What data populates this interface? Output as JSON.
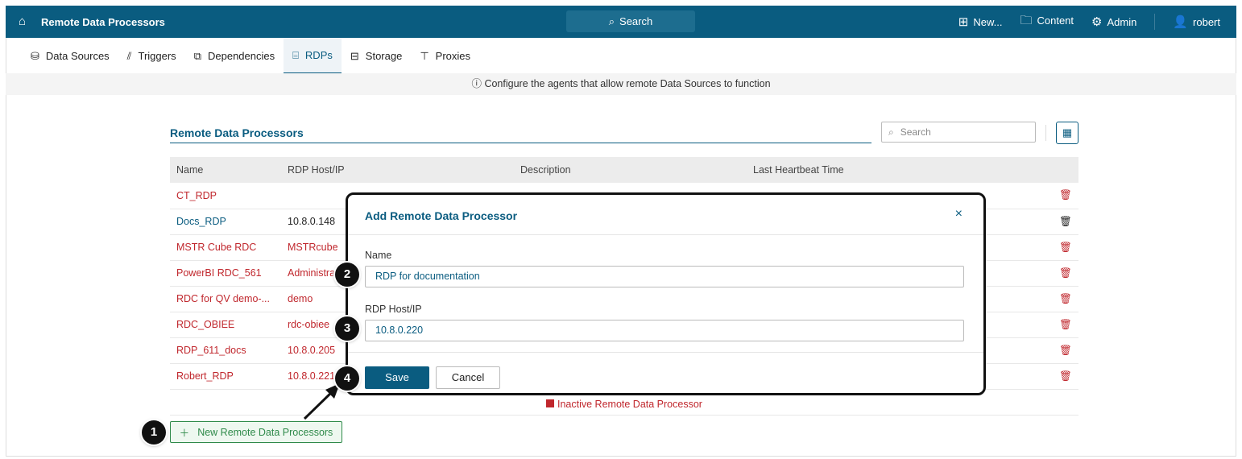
{
  "header": {
    "title": "Remote Data Processors",
    "search_label": "Search",
    "new_label": "New...",
    "content_label": "Content",
    "admin_label": "Admin",
    "user_label": "robert"
  },
  "tabs": [
    {
      "label": "Data Sources"
    },
    {
      "label": "Triggers"
    },
    {
      "label": "Dependencies"
    },
    {
      "label": "RDPs"
    },
    {
      "label": "Storage"
    },
    {
      "label": "Proxies"
    }
  ],
  "info": "Configure the agents that allow remote Data Sources to function",
  "page": {
    "title": "Remote Data Processors",
    "search_placeholder": "Search"
  },
  "table": {
    "columns": [
      "Name",
      "RDP Host/IP",
      "Description",
      "Last Heartbeat Time"
    ],
    "rows": [
      {
        "name": "CT_RDP",
        "host": "",
        "status": "inactive"
      },
      {
        "name": "Docs_RDP",
        "host": "10.8.0.148",
        "status": "active"
      },
      {
        "name": "MSTR Cube RDC",
        "host": "MSTRcube",
        "status": "inactive"
      },
      {
        "name": "PowerBI RDC_561",
        "host": "Administra",
        "status": "inactive"
      },
      {
        "name": "RDC for QV demo-...",
        "host": "demo",
        "status": "inactive"
      },
      {
        "name": "RDC_OBIEE",
        "host": "rdc-obiee",
        "status": "inactive"
      },
      {
        "name": "RDP_611_docs",
        "host": "10.8.0.205",
        "status": "inactive"
      },
      {
        "name": "Robert_RDP",
        "host": "10.8.0.221",
        "status": "inactive"
      }
    ]
  },
  "legend": "Inactive Remote Data Processor",
  "new_button": "New Remote Data Processors",
  "modal": {
    "title": "Add Remote Data Processor",
    "name_label": "Name",
    "name_value": "RDP for documentation",
    "host_label": "RDP Host/IP",
    "host_value": "10.8.0.220",
    "save": "Save",
    "cancel": "Cancel"
  },
  "callouts": [
    "1",
    "2",
    "3",
    "4"
  ],
  "colors": {
    "brand": "#0a5c80",
    "inactive": "#c0272d",
    "new": "#2f8a4a"
  }
}
